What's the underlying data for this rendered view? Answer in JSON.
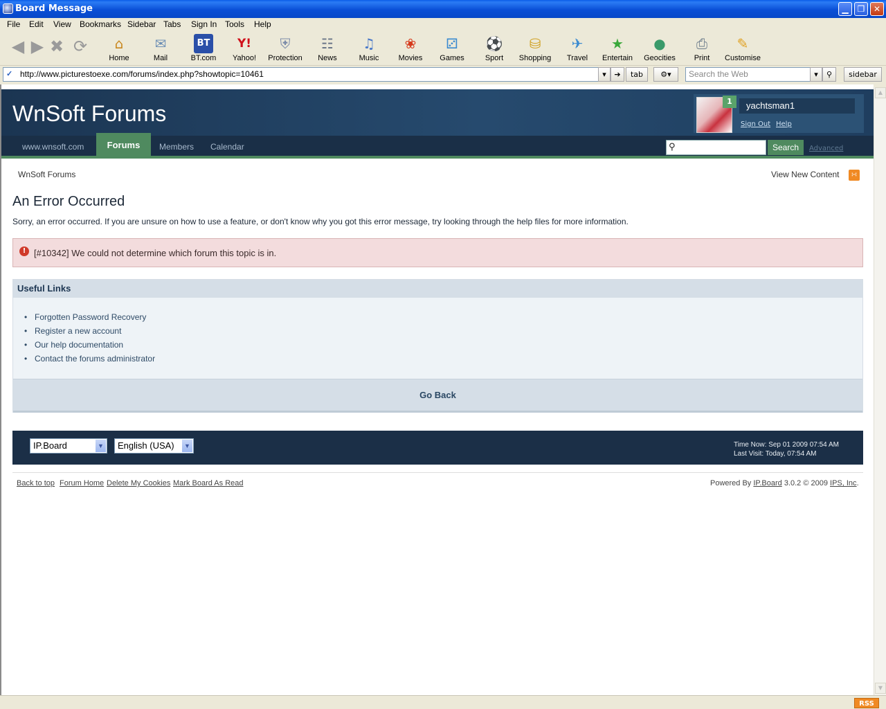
{
  "window": {
    "title": "Board Message",
    "min": "▁",
    "max": "❒",
    "close": "✕"
  },
  "menu": [
    "File",
    "Edit",
    "View",
    "Bookmarks",
    "Sidebar",
    "Tabs",
    "Sign In",
    "Tools",
    "Help"
  ],
  "toolbar": {
    "buttons": [
      {
        "label": "Home",
        "icon": "⌂"
      },
      {
        "label": "Mail",
        "icon": "✉"
      },
      {
        "label": "BT.com",
        "icon": "BT"
      },
      {
        "label": "Yahoo!",
        "icon": "Y!"
      },
      {
        "label": "Protection",
        "icon": "⛨"
      },
      {
        "label": "News",
        "icon": "☷"
      },
      {
        "label": "Music",
        "icon": "♫"
      },
      {
        "label": "Movies",
        "icon": "❀"
      },
      {
        "label": "Games",
        "icon": "⚂"
      },
      {
        "label": "Sport",
        "icon": "⚽"
      },
      {
        "label": "Shopping",
        "icon": "⛁"
      },
      {
        "label": "Travel",
        "icon": "✈"
      },
      {
        "label": "Entertain",
        "icon": "★"
      },
      {
        "label": "Geocities",
        "icon": "●"
      },
      {
        "label": "Print",
        "icon": "⎙"
      },
      {
        "label": "Customise",
        "icon": "✎"
      }
    ]
  },
  "address": {
    "url": "http://www.picturestoexe.com/forums/index.php?showtopic=10461",
    "tab_label": "tab",
    "search_placeholder": "Search the Web",
    "sidebar_label": "sidebar"
  },
  "forum": {
    "logo": "WnSoft Forums",
    "user": {
      "name": "yachtsman1",
      "notifications": "1",
      "sign_out": "Sign Out",
      "help": "Help"
    },
    "nav": {
      "site": "www.wnsoft.com",
      "forums": "Forums",
      "members": "Members",
      "calendar": "Calendar"
    },
    "search": {
      "button": "Search",
      "advanced": "Advanced"
    },
    "breadcrumb": "WnSoft Forums",
    "view_new": "View New Content",
    "error": {
      "title": "An Error Occurred",
      "description": "Sorry, an error occurred. If you are unsure on how to use a feature, or don't know why you got this error message, try looking through the help files for more information.",
      "message": "[#10342] We could not determine which forum this topic is in."
    },
    "useful": {
      "header": "Useful Links",
      "links": [
        "Forgotten Password Recovery",
        "Register a new account",
        "Our help documentation",
        "Contact the forums administrator"
      ],
      "go_back": "Go Back"
    },
    "footer": {
      "skin": "IP.Board",
      "language": "English (USA)",
      "time_now": "Time Now: Sep 01 2009 07:54 AM",
      "last_visit": "Last Visit: Today, 07:54 AM"
    },
    "bottom_links": [
      "Back to top",
      "Forum Home",
      "Delete My Cookies",
      "Mark Board As Read"
    ],
    "powered": {
      "prefix": "Powered By ",
      "product": "IP.Board",
      "version": " 3.0.2 © 2009 ",
      "company": "IPS, Inc",
      "suffix": "."
    }
  },
  "status": {
    "rss": "RSS"
  }
}
